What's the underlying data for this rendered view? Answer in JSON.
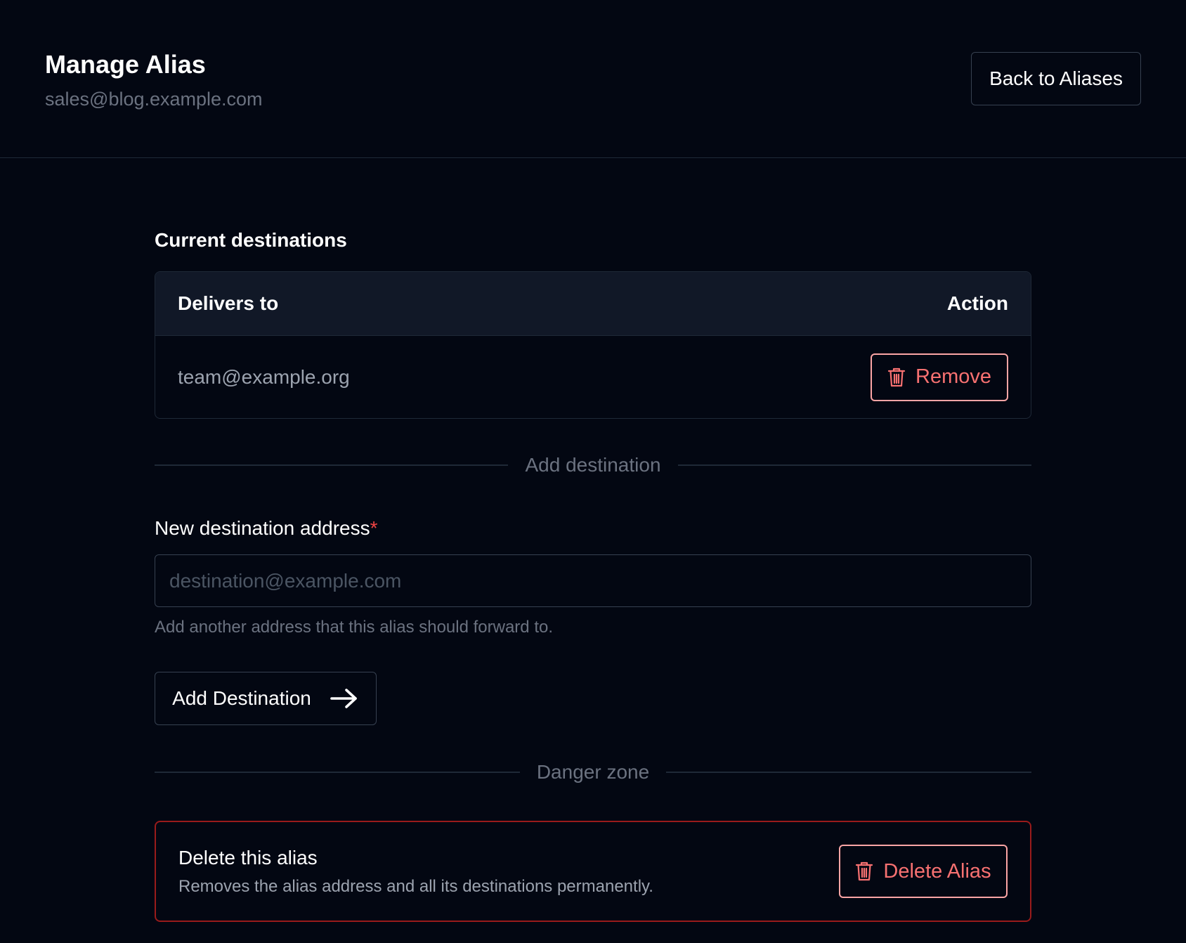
{
  "header": {
    "title": "Manage Alias",
    "subtitle": "sales@blog.example.com",
    "back_label": "Back to Aliases"
  },
  "destinations": {
    "section_title": "Current destinations",
    "columns": [
      "Delivers to",
      "Action"
    ],
    "rows": [
      {
        "address": "team@example.org",
        "action_label": "Remove",
        "action_icon": "trash-icon"
      }
    ]
  },
  "add_destination": {
    "divider_label": "Add destination",
    "field_label": "New destination address",
    "required_marker": "*",
    "placeholder": "destination@example.com",
    "value": "",
    "help_text": "Add another address that this alias should forward to.",
    "submit_label": "Add Destination",
    "submit_icon": "arrow-right-icon"
  },
  "danger_zone": {
    "divider_label": "Danger zone",
    "title": "Delete this alias",
    "description": "Removes the alias address and all its destinations permanently.",
    "delete_label": "Delete Alias",
    "delete_icon": "trash-icon"
  },
  "colors": {
    "background": "#030712",
    "danger": "#f87171",
    "danger_border": "#991b1b",
    "muted_text": "#6b7280",
    "required": "#ef4444"
  }
}
